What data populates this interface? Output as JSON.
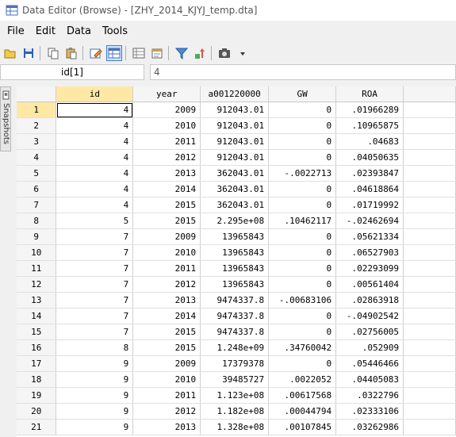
{
  "window": {
    "title": "Data Editor (Browse) - [ZHY_2014_KJYJ_temp.dta]"
  },
  "menu": [
    "File",
    "Edit",
    "Data",
    "Tools"
  ],
  "toolbar": [
    {
      "icon": "open-icon",
      "active": false
    },
    {
      "icon": "save-icon",
      "active": false
    },
    {
      "sep": true
    },
    {
      "icon": "copy-icon",
      "active": false
    },
    {
      "icon": "paste-icon",
      "active": false
    },
    {
      "sep": true
    },
    {
      "icon": "edit-mode-icon",
      "active": false
    },
    {
      "icon": "browse-mode-icon",
      "active": true
    },
    {
      "sep": true
    },
    {
      "icon": "variables-manager-icon",
      "active": false
    },
    {
      "icon": "properties-icon",
      "active": false
    },
    {
      "sep": true
    },
    {
      "icon": "filter-icon",
      "active": false
    },
    {
      "icon": "sort-icon",
      "active": false
    },
    {
      "sep": true
    },
    {
      "icon": "snapshot-icon",
      "active": false
    },
    {
      "icon": "dropdown-arrow-icon",
      "active": false
    }
  ],
  "cell_ref": "id[1]",
  "cell_value": "4",
  "snapshots_label": "Snapshots",
  "columns": [
    {
      "label": "",
      "width": 50
    },
    {
      "label": "id",
      "width": 97
    },
    {
      "label": "year",
      "width": 85
    },
    {
      "label": "a001220000",
      "width": 86
    },
    {
      "label": "GW",
      "width": 85
    },
    {
      "label": "ROA",
      "width": 85
    },
    {
      "label": "",
      "width": 66
    }
  ],
  "rows": [
    [
      "1",
      "4",
      "2009",
      "912043.01",
      "0",
      ".01966289"
    ],
    [
      "2",
      "4",
      "2010",
      "912043.01",
      "0",
      ".10965875"
    ],
    [
      "3",
      "4",
      "2011",
      "912043.01",
      "0",
      ".04683"
    ],
    [
      "4",
      "4",
      "2012",
      "912043.01",
      "0",
      ".04050635"
    ],
    [
      "5",
      "4",
      "2013",
      "362043.01",
      "-.0022713",
      ".02393847"
    ],
    [
      "6",
      "4",
      "2014",
      "362043.01",
      "0",
      ".04618864"
    ],
    [
      "7",
      "4",
      "2015",
      "362043.01",
      "0",
      ".01719992"
    ],
    [
      "8",
      "5",
      "2015",
      "2.295e+08",
      ".10462117",
      "-.02462694"
    ],
    [
      "9",
      "7",
      "2009",
      "13965843",
      "0",
      ".05621334"
    ],
    [
      "10",
      "7",
      "2010",
      "13965843",
      "0",
      ".06527903"
    ],
    [
      "11",
      "7",
      "2011",
      "13965843",
      "0",
      ".02293099"
    ],
    [
      "12",
      "7",
      "2012",
      "13965843",
      "0",
      ".00561404"
    ],
    [
      "13",
      "7",
      "2013",
      "9474337.8",
      "-.00683106",
      ".02863918"
    ],
    [
      "14",
      "7",
      "2014",
      "9474337.8",
      "0",
      "-.04902542"
    ],
    [
      "15",
      "7",
      "2015",
      "9474337.8",
      "0",
      ".02756005"
    ],
    [
      "16",
      "8",
      "2015",
      "1.248e+09",
      ".34760042",
      ".052909"
    ],
    [
      "17",
      "9",
      "2009",
      "17379378",
      "0",
      ".05446466"
    ],
    [
      "18",
      "9",
      "2010",
      "39485727",
      ".0022052",
      ".04405083"
    ],
    [
      "19",
      "9",
      "2011",
      "1.123e+08",
      ".00617568",
      ".0322796"
    ],
    [
      "20",
      "9",
      "2012",
      "1.182e+08",
      ".00044794",
      ".02333106"
    ],
    [
      "21",
      "9",
      "2013",
      "1.328e+08",
      ".00107845",
      ".03262986"
    ]
  ],
  "selection": {
    "row": 0,
    "col": 1
  }
}
